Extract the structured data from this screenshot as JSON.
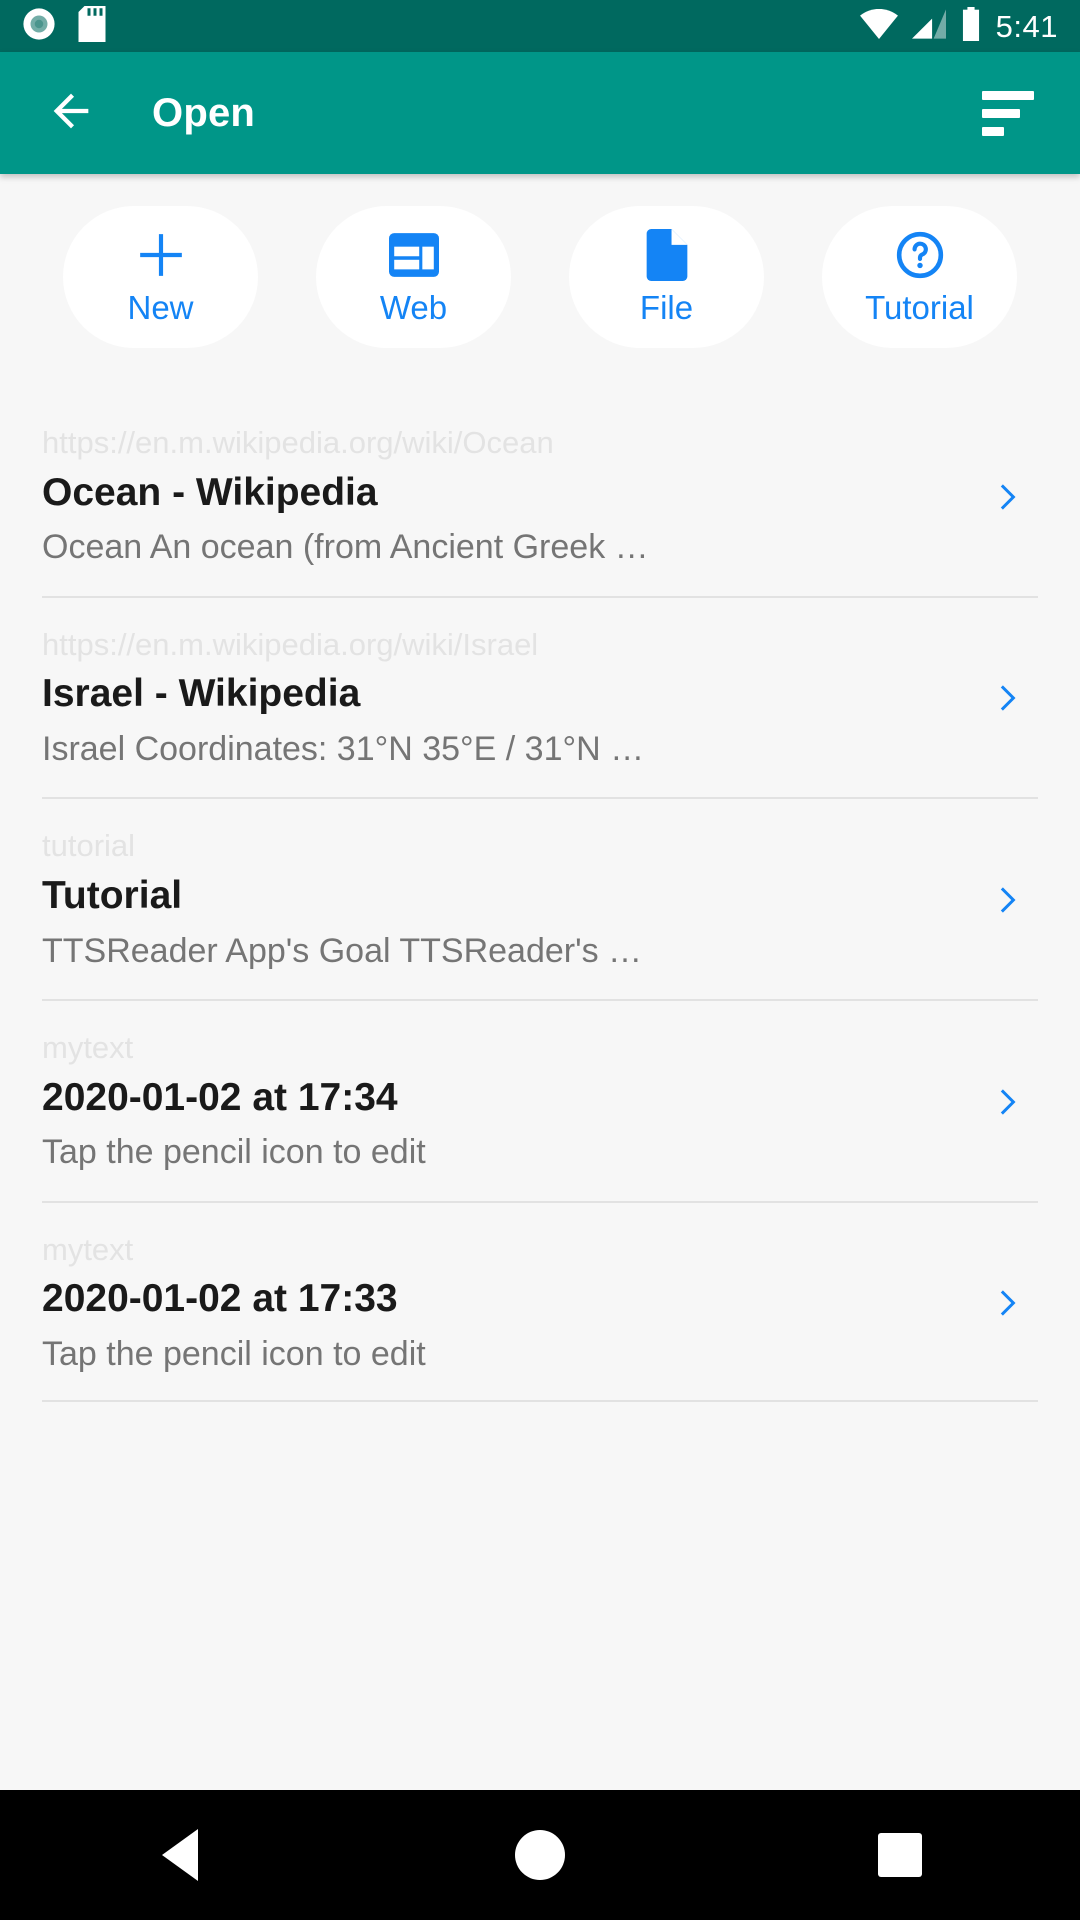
{
  "status_bar": {
    "time": "5:41",
    "icons_left": [
      "record-disc-icon",
      "sd-card-icon"
    ],
    "icons_right": [
      "wifi-icon",
      "cellular-signal-icon",
      "battery-icon"
    ],
    "background": "#00695f"
  },
  "app_bar": {
    "title": "Open",
    "back_icon": "arrow-back-icon",
    "menu_icon": "sort-menu-icon",
    "background": "#009688"
  },
  "quick_actions": [
    {
      "label": "New",
      "icon": "plus-icon"
    },
    {
      "label": "Web",
      "icon": "web-layout-icon"
    },
    {
      "label": "File",
      "icon": "document-icon"
    },
    {
      "label": "Tutorial",
      "icon": "help-circle-icon"
    }
  ],
  "accent_color": "#1484f5",
  "list": [
    {
      "source": "https://en.m.wikipedia.org/wiki/Ocean",
      "title": "Ocean - Wikipedia",
      "description": "Ocean     An ocean (from Ancient Greek  …"
    },
    {
      "source": "https://en.m.wikipedia.org/wiki/Israel",
      "title": "Israel - Wikipedia",
      "description": "Israel     Coordinates: 31°N 35°E / 31°N …"
    },
    {
      "source": "tutorial",
      "title": "Tutorial",
      "description": "TTSReader     App's Goal     TTSReader's …"
    },
    {
      "source": "mytext",
      "title": "2020-01-02 at 17:34",
      "description": "Tap the pencil icon to edit"
    },
    {
      "source": "mytext",
      "title": "2020-01-02 at 17:33",
      "description": "Tap the pencil icon to edit"
    }
  ],
  "nav_bar": {
    "back": "back-triangle-icon",
    "home": "home-circle-icon",
    "recents": "recents-square-icon"
  }
}
